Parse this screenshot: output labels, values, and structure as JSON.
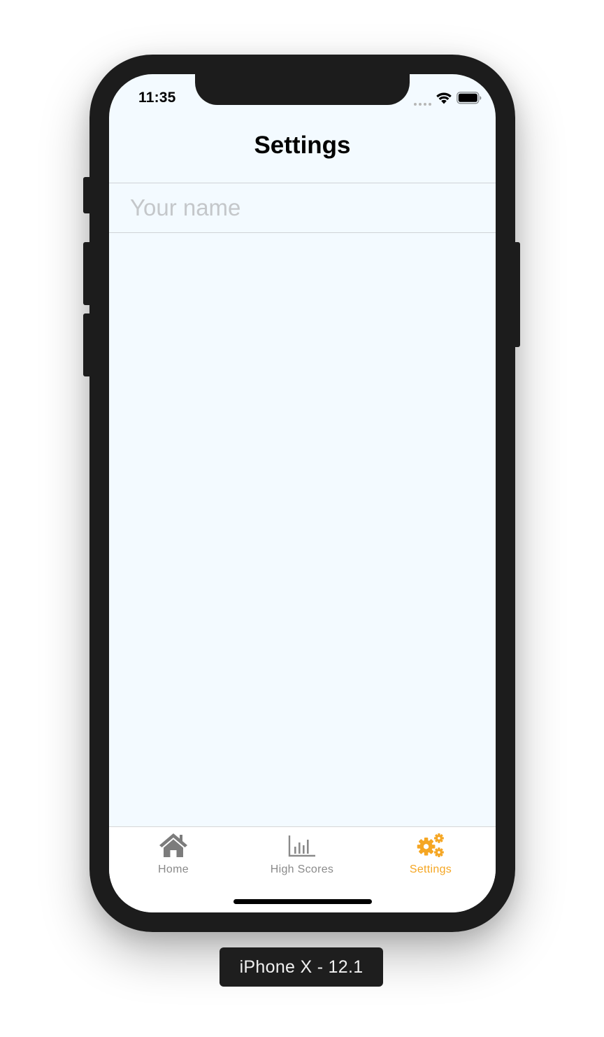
{
  "status_bar": {
    "time": "11:35"
  },
  "nav": {
    "title": "Settings"
  },
  "name_field": {
    "placeholder": "Your name",
    "value": ""
  },
  "tabs": [
    {
      "label": "Home",
      "icon": "home-icon",
      "active": false
    },
    {
      "label": "High Scores",
      "icon": "bar-chart-icon",
      "active": false
    },
    {
      "label": "Settings",
      "icon": "gears-icon",
      "active": true
    }
  ],
  "colors": {
    "active_tab": "#f5a623",
    "inactive_tab": "#8a8a8a",
    "screen_background": "#f3faff"
  },
  "device_label": "iPhone X - 12.1"
}
